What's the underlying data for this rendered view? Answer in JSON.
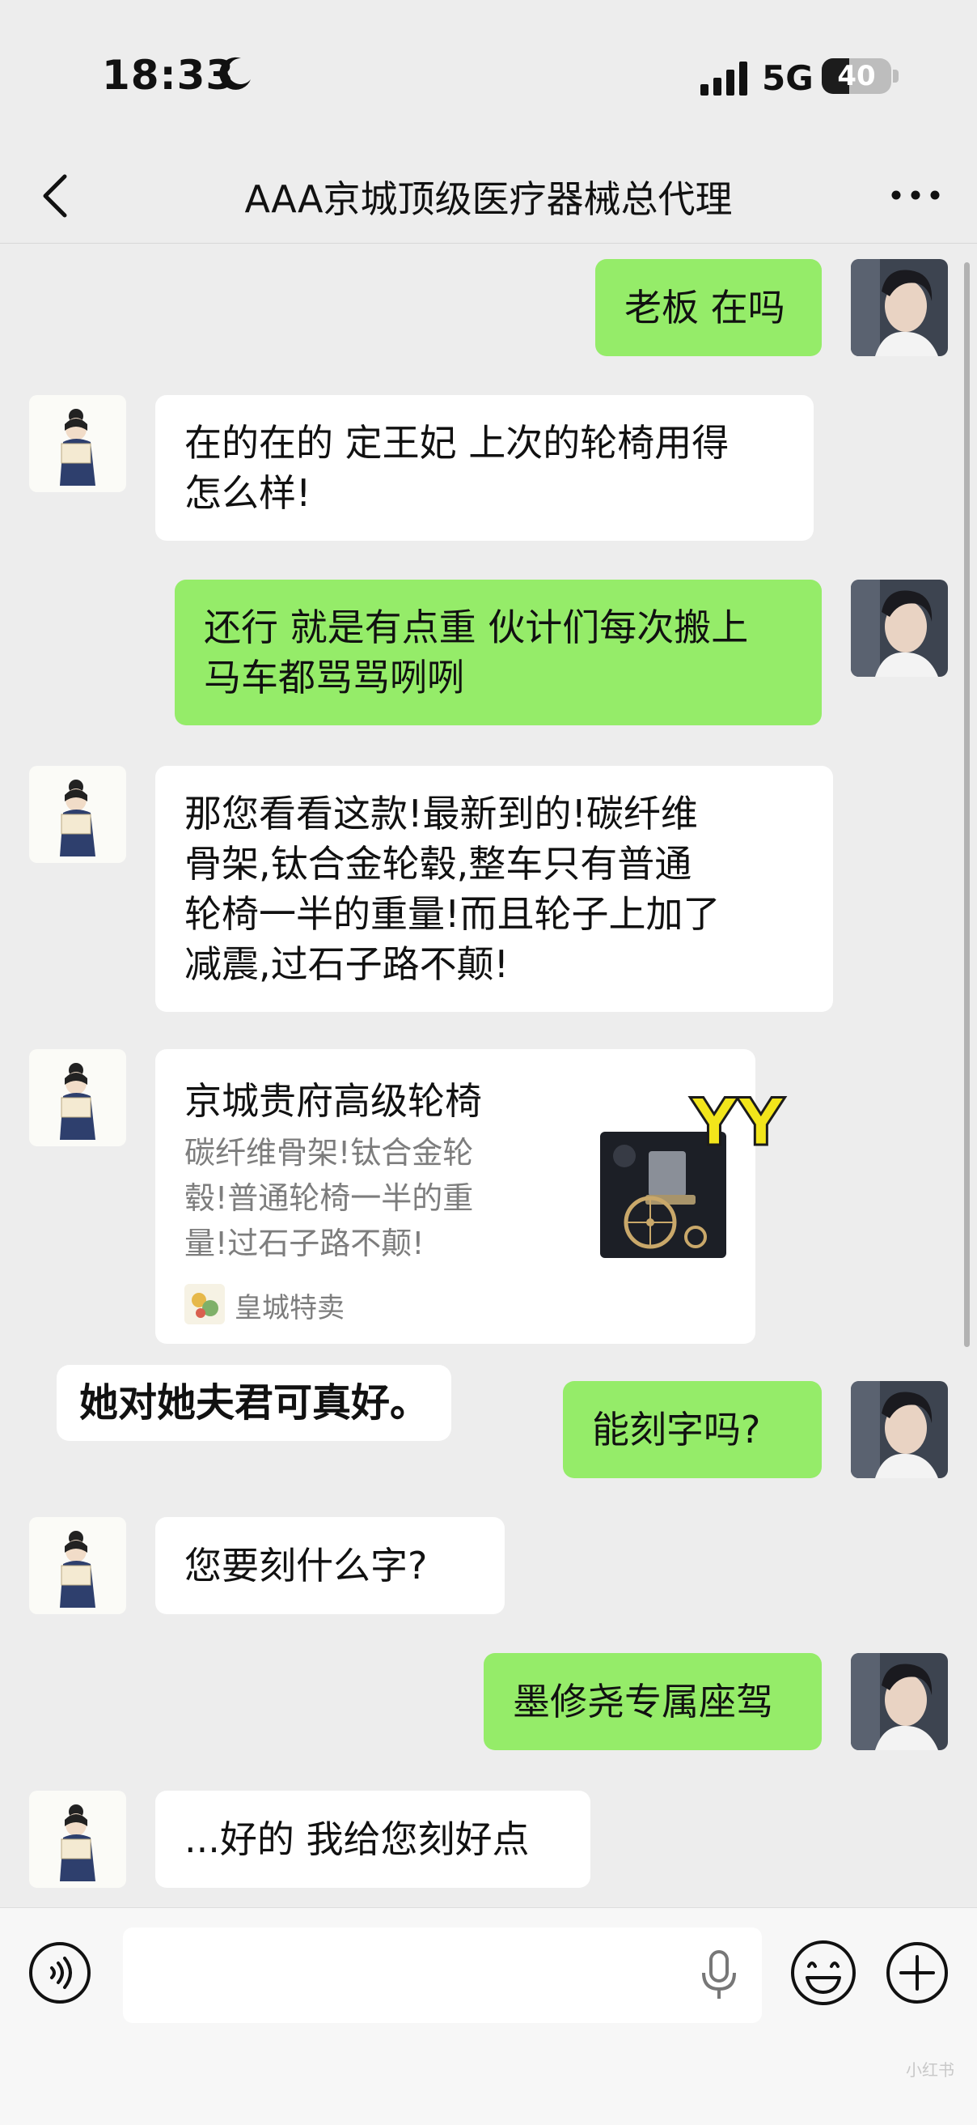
{
  "status_bar": {
    "time": "18:33",
    "network": "5G",
    "battery": "40",
    "battery_level": 0.4
  },
  "header": {
    "title": "AAA京城顶级医疗器械总代理"
  },
  "messages": [
    {
      "from": "me",
      "lines": [
        "老板 在吗"
      ]
    },
    {
      "from": "them",
      "lines": [
        "在的在的 定王妃 上次的轮椅用得",
        "怎么样!"
      ]
    },
    {
      "from": "me",
      "lines": [
        "还行 就是有点重 伙计们每次搬上",
        "马车都骂骂咧咧"
      ]
    },
    {
      "from": "them",
      "lines": [
        "那您看看这款!最新到的!碳纤维",
        "骨架,钛合金轮毂,整车只有普通",
        "轮椅一半的重量!而且轮子上加了",
        "减震,过石子路不颠!"
      ]
    },
    {
      "from": "me",
      "lines": [
        "能刻字吗?"
      ]
    },
    {
      "from": "them",
      "lines": [
        "您要刻什么字?"
      ]
    },
    {
      "from": "me",
      "lines": [
        "墨修尧专属座驾"
      ]
    },
    {
      "from": "them",
      "lines": [
        "...好的 我给您刻好点"
      ]
    }
  ],
  "card": {
    "title": "京城贵府高级轮椅",
    "desc_lines": [
      "碳纤维骨架!钛合金轮",
      "毂!普通轮椅一半的重",
      "量!过石子路不颠!"
    ],
    "source": "皇城特卖",
    "image_icon": "wheelchair-thumbnail"
  },
  "sticker": {
    "text": "YY"
  },
  "caption": "她对她夫君可真好。",
  "input_bar": {
    "voice_icon": "voice-icon",
    "mic_icon": "mic-icon",
    "emoji_icon": "emoji-icon",
    "plus_icon": "plus-icon"
  },
  "watermark": "小红书",
  "colors": {
    "background": "#ededed",
    "me_bubble": "#95ec69",
    "them_bubble": "#ffffff",
    "secondary_text": "#7d7d7d"
  }
}
